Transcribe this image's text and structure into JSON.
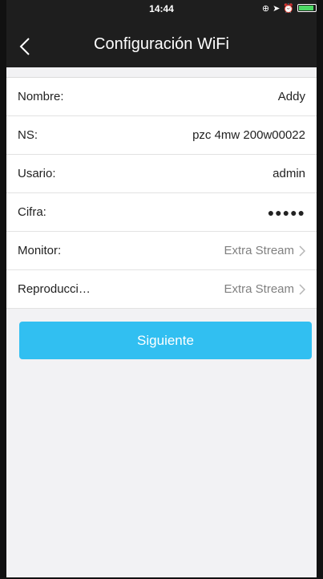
{
  "status_bar": {
    "time": "14:44"
  },
  "nav": {
    "title": "Configuración WiFi"
  },
  "rows": [
    {
      "label": "Nombre:",
      "value": "Addy"
    },
    {
      "label": "NS:",
      "value": "pzc 4mw 200w00022"
    },
    {
      "label": "Usario:",
      "value": "admin"
    },
    {
      "label": "Cifra:",
      "value": "●●●●●"
    },
    {
      "label": "Monitor:",
      "value": "Extra Stream"
    },
    {
      "label": "Reproducci…",
      "value": "Extra Stream"
    }
  ],
  "actions": {
    "next_label": "Siguiente"
  },
  "colors": {
    "accent": "#31bff1",
    "header_bg": "#1e1e1e"
  },
  "icons": [
    "back-chevron-icon",
    "chevron-right-icon",
    "lock-rotation-icon",
    "location-icon",
    "alarm-icon",
    "battery-icon"
  ]
}
